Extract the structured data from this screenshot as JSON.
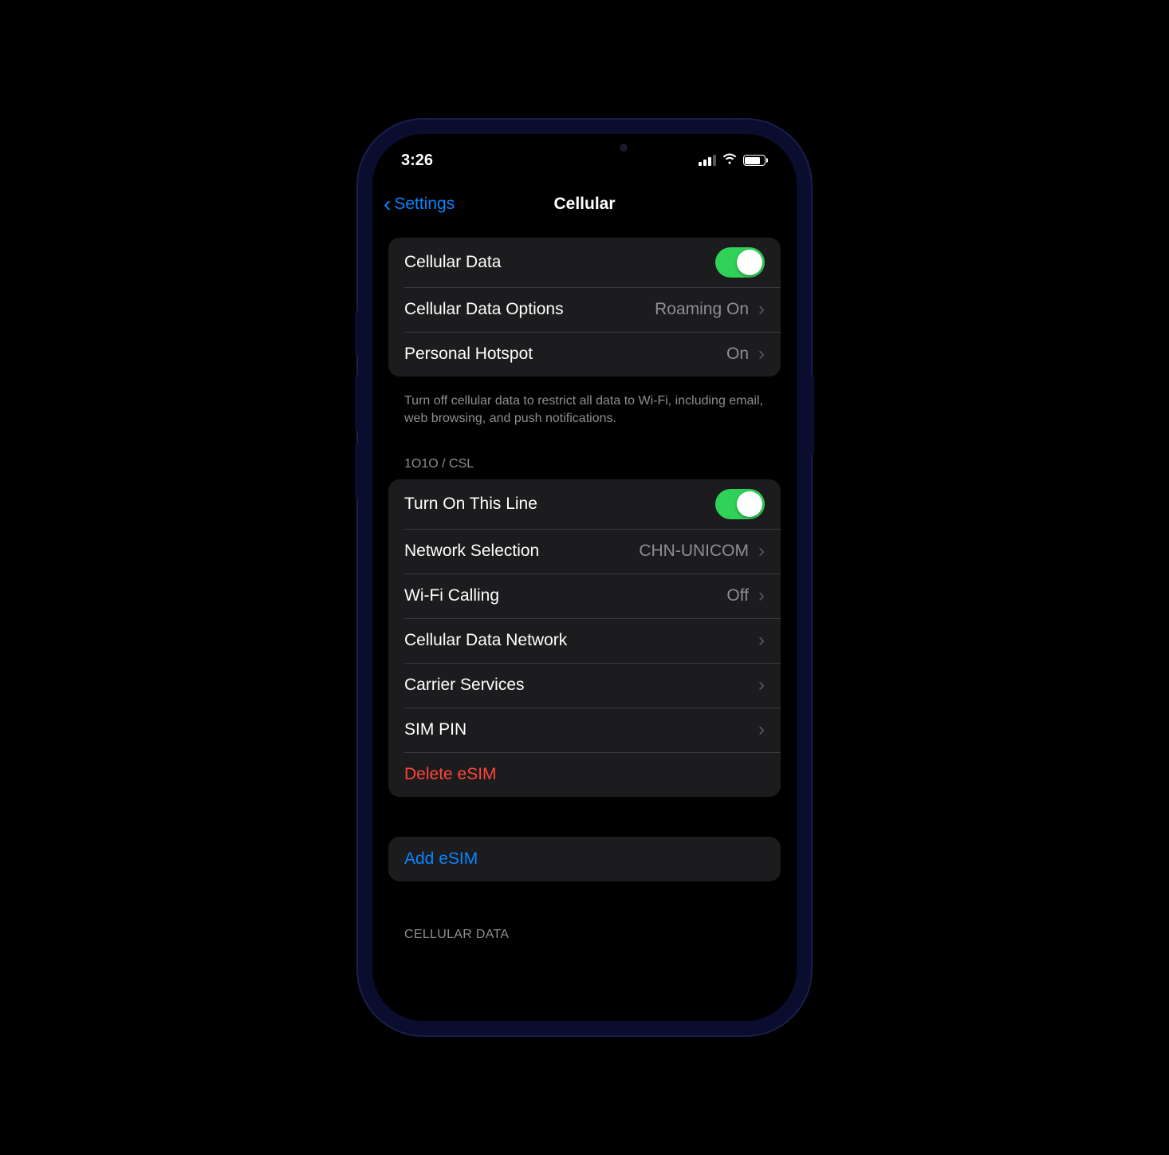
{
  "status": {
    "time": "3:26"
  },
  "nav": {
    "back": "Settings",
    "title": "Cellular"
  },
  "group1": {
    "cellular_data": {
      "label": "Cellular Data",
      "on": true
    },
    "cellular_data_options": {
      "label": "Cellular Data Options",
      "value": "Roaming On"
    },
    "personal_hotspot": {
      "label": "Personal Hotspot",
      "value": "On"
    },
    "footer": "Turn off cellular data to restrict all data to Wi-Fi, including email, web browsing, and push notifications."
  },
  "carrier_header": "1O1O / CSL",
  "group2": {
    "turn_on_line": {
      "label": "Turn On This Line",
      "on": true
    },
    "network_selection": {
      "label": "Network Selection",
      "value": "CHN-UNICOM"
    },
    "wifi_calling": {
      "label": "Wi-Fi Calling",
      "value": "Off"
    },
    "cellular_data_network": {
      "label": "Cellular Data Network"
    },
    "carrier_services": {
      "label": "Carrier Services"
    },
    "sim_pin": {
      "label": "SIM PIN"
    },
    "delete_esim": {
      "label": "Delete eSIM"
    }
  },
  "group3": {
    "add_esim": {
      "label": "Add eSIM"
    }
  },
  "cellular_data_header": "CELLULAR DATA"
}
